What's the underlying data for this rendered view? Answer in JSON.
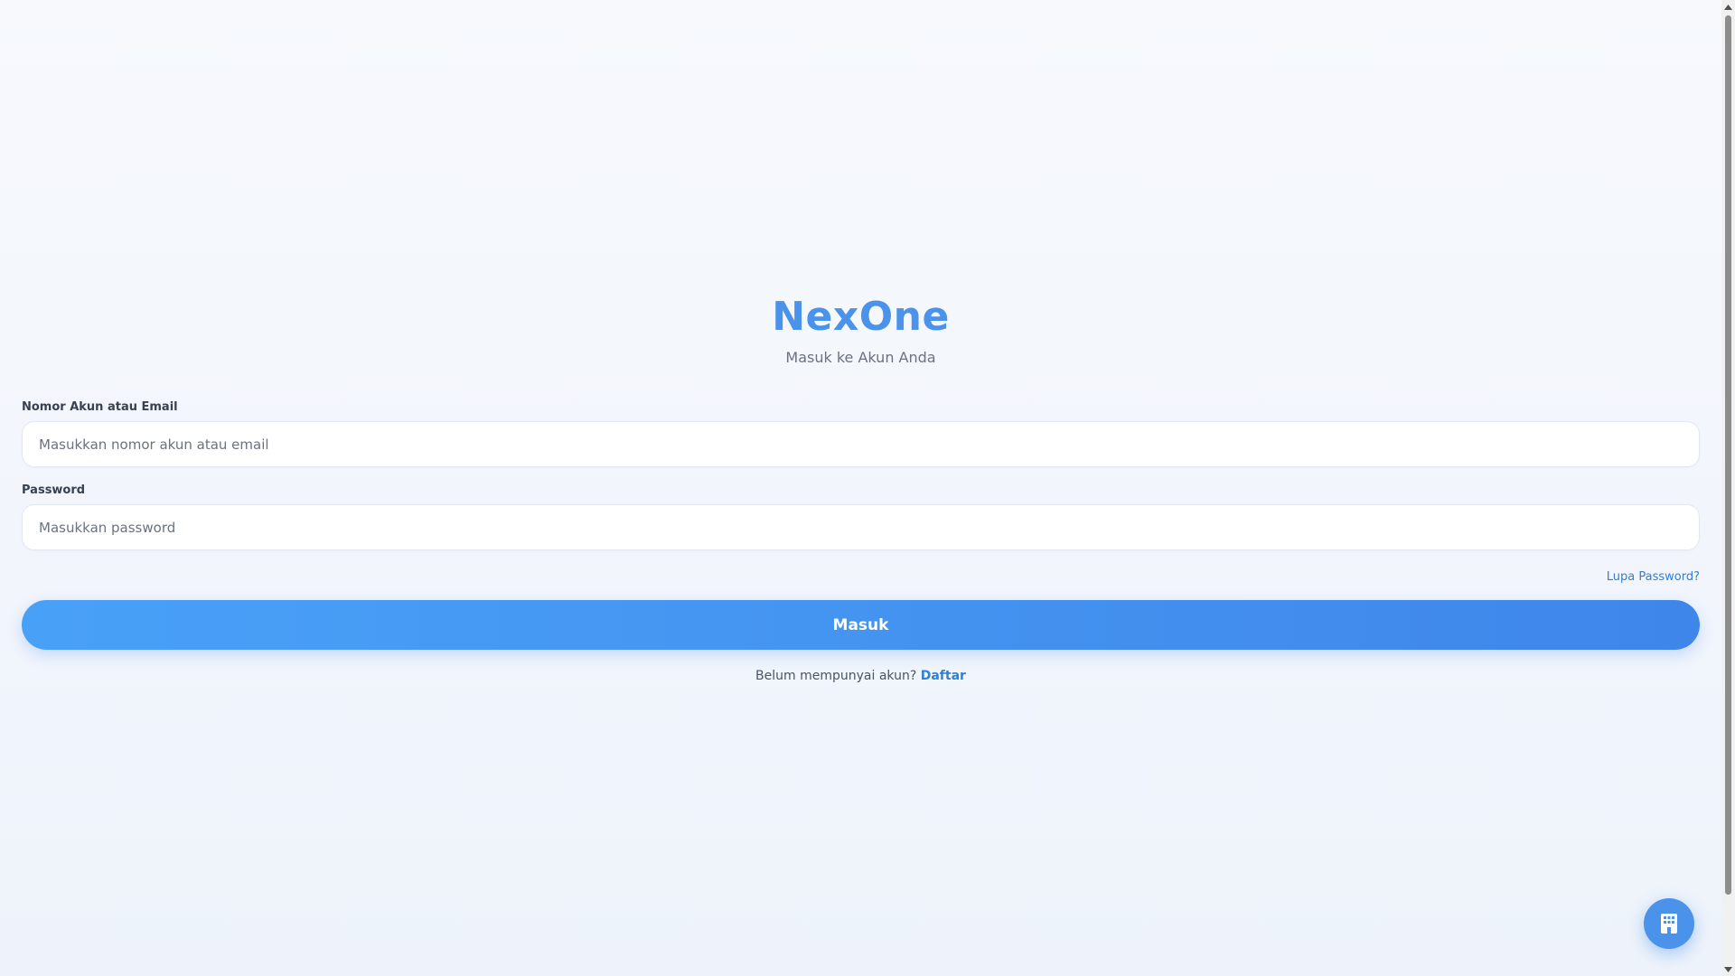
{
  "brand": {
    "name": "NexOne",
    "subtitle": "Masuk ke Akun Anda",
    "accent_color": "#4a92ea"
  },
  "form": {
    "account": {
      "label": "Nomor Akun atau Email",
      "placeholder": "Masukkan nomor akun atau email",
      "value": ""
    },
    "password": {
      "label": "Password",
      "placeholder": "Masukkan password",
      "value": ""
    },
    "forgot_label": "Lupa Password?",
    "submit_label": "Masuk"
  },
  "register": {
    "prompt": "Belum mempunyai akun?",
    "link_label": "Daftar"
  },
  "fab": {
    "icon": "building-icon"
  }
}
